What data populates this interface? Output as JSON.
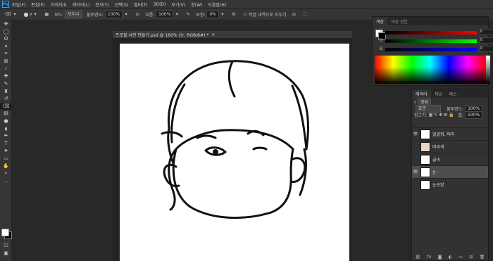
{
  "menubar": {
    "logo": "Ps",
    "items": [
      "파일(F)",
      "편집(E)",
      "이미지(I)",
      "레이어(L)",
      "문자(Y)",
      "선택(S)",
      "필터(T)",
      "3D(D)",
      "보기(V)",
      "창(W)",
      "도움말(H)"
    ]
  },
  "options": {
    "brush_size": "9",
    "mode_label": "모드:",
    "mode_value": "보러시",
    "opacity_label": "불투명도:",
    "opacity_value": "100%",
    "flow_label": "흐름:",
    "flow_value": "100%",
    "smoothing_label": "보정:",
    "smoothing_value": "0%",
    "erase_history": "작업 내역으로 지우기"
  },
  "document": {
    "title": "프로필 사진 만들기.psd @ 160% (눈, RGB/8#) *",
    "close": "×"
  },
  "color_panel": {
    "tabs": [
      "색상",
      "색상 견본"
    ],
    "sliders": [
      {
        "label": "R",
        "value": "0"
      },
      {
        "label": "G",
        "value": "0"
      },
      {
        "label": "B",
        "value": "0"
      }
    ]
  },
  "layers_panel": {
    "tabs": [
      "레이어",
      "채널",
      "패스"
    ],
    "filter_label": "종류",
    "blend_mode": "표준",
    "opacity_label": "불투명도:",
    "opacity_value": "100%",
    "lock_label": "잠그기:",
    "fill_label": "칠:",
    "fill_value": "100%",
    "layers": [
      {
        "name": "얼굴형, 머리",
        "visible": true,
        "selected": false
      },
      {
        "name": "머리색",
        "visible": false,
        "selected": false
      },
      {
        "name": "글씨",
        "visible": false,
        "selected": false
      },
      {
        "name": "눈",
        "visible": true,
        "selected": true
      },
      {
        "name": "눈모양",
        "visible": false,
        "selected": false
      }
    ],
    "footer_icons": [
      "link-icon",
      "fx-icon",
      "mask-icon",
      "adjustment-icon",
      "group-icon",
      "new-layer-icon",
      "trash-icon"
    ]
  },
  "colors": {
    "accent": "#31a8ff",
    "panel_bg": "#323232",
    "app_bg": "#282828"
  }
}
